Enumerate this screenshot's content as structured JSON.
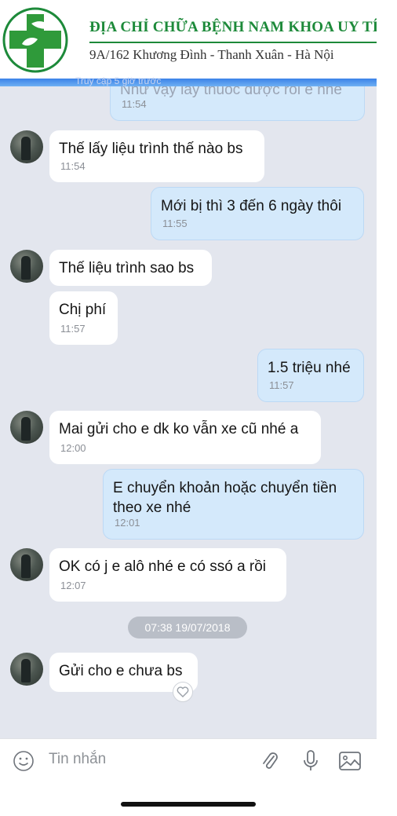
{
  "banner": {
    "title": "ĐỊA CHỈ CHỮA BỆNH NAM KHOA UY TÍN",
    "address": "9A/162  Khương Đình - Thanh Xuân - Hà Nội"
  },
  "top_partial": {
    "faded_text": "Truy cập 5 giờ trước",
    "bubble_text": "Như vậy lấy thuốc được rồi e nhé",
    "time": "11:54"
  },
  "messages": [
    {
      "side": "in",
      "text": "Thế lấy liệu trình thế nào bs",
      "time": "11:54"
    },
    {
      "side": "out",
      "text": "Mới bị thì 3 đến 6 ngày thôi",
      "time": "11:55"
    },
    {
      "side": "in",
      "text": "Thế liệu trình sao bs",
      "time": ""
    },
    {
      "side": "in",
      "text": "Chị phí",
      "time": "11:57"
    },
    {
      "side": "out",
      "text": "1.5 triệu nhé",
      "time": "11:57"
    },
    {
      "side": "in",
      "text": "Mai gửi cho e dk ko vẫn xe cũ nhé a",
      "time": "12:00"
    },
    {
      "side": "out",
      "text": "E chuyển khoản hoặc chuyển tiền theo xe nhé",
      "time": "12:01"
    },
    {
      "side": "in",
      "text": "OK có j e alô nhé e có ssó a rồi",
      "time": "12:07"
    },
    {
      "side": "in",
      "text": "Gửi cho e chưa bs",
      "time": ""
    }
  ],
  "date_divider": "07:38 19/07/2018",
  "input": {
    "placeholder": "Tin nhắn",
    "icons": [
      "emoji-icon",
      "attachment-icon",
      "microphone-icon",
      "image-icon"
    ]
  },
  "colors": {
    "brand_green": "#1d8a3a",
    "outgoing_bubble": "#d4e9fb",
    "incoming_bubble": "#ffffff",
    "chat_background": "#e3e6ee"
  }
}
